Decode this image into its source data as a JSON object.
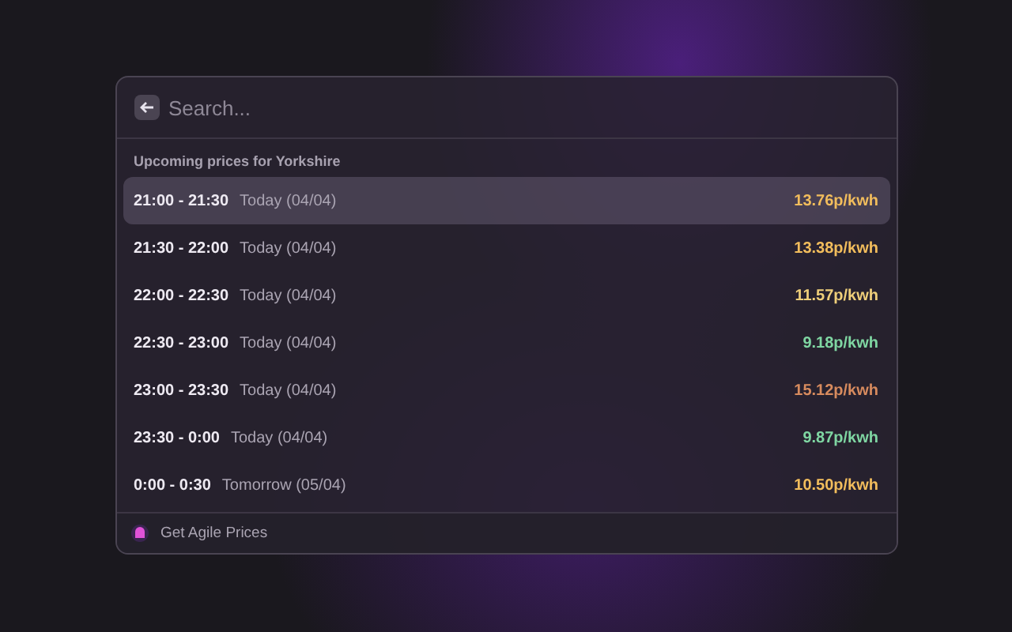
{
  "search": {
    "placeholder": "Search..."
  },
  "section_title": "Upcoming prices for Yorkshire",
  "rows": [
    {
      "time": "21:00 - 21:30",
      "day": "Today (04/04)",
      "price": "13.76p/kwh",
      "color": "#f2bd5c",
      "selected": true
    },
    {
      "time": "21:30 - 22:00",
      "day": "Today (04/04)",
      "price": "13.38p/kwh",
      "color": "#f2bd5c",
      "selected": false
    },
    {
      "time": "22:00 - 22:30",
      "day": "Today (04/04)",
      "price": "11.57p/kwh",
      "color": "#efcf7a",
      "selected": false
    },
    {
      "time": "22:30 - 23:00",
      "day": "Today (04/04)",
      "price": "9.18p/kwh",
      "color": "#7fd6a2",
      "selected": false
    },
    {
      "time": "23:00 - 23:30",
      "day": "Today (04/04)",
      "price": "15.12p/kwh",
      "color": "#d78b5e",
      "selected": false
    },
    {
      "time": "23:30 - 0:00",
      "day": "Today (04/04)",
      "price": "9.87p/kwh",
      "color": "#7fd6a2",
      "selected": false
    },
    {
      "time": "0:00 - 0:30",
      "day": "Tomorrow (05/04)",
      "price": "10.50p/kwh",
      "color": "#f2bd5c",
      "selected": false
    }
  ],
  "footer": {
    "label": "Get Agile Prices"
  }
}
